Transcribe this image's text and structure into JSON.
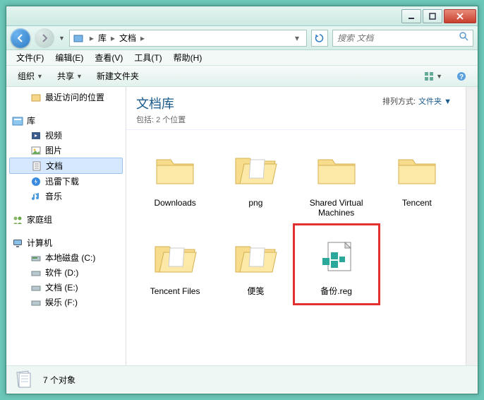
{
  "titlebar": {},
  "nav": {
    "breadcrumb": {
      "root": "库",
      "current": "文档"
    }
  },
  "search": {
    "placeholder": "搜索 文档"
  },
  "menubar": {
    "file": "文件(F)",
    "edit": "编辑(E)",
    "view": "查看(V)",
    "tools": "工具(T)",
    "help": "帮助(H)"
  },
  "toolbar": {
    "organize": "组织",
    "share": "共享",
    "newfolder": "新建文件夹"
  },
  "sidebar": {
    "recent": "最近访问的位置",
    "libraries": "库",
    "lib_items": {
      "videos": "视频",
      "pictures": "图片",
      "documents": "文档",
      "xunlei": "迅雷下载",
      "music": "音乐"
    },
    "homegroup": "家庭组",
    "computer": "计算机",
    "drives": {
      "c": "本地磁盘 (C:)",
      "d": "软件 (D:)",
      "e": "文档 (E:)",
      "f": "娱乐 (F:)"
    }
  },
  "header": {
    "title": "文档库",
    "subtitle": "包括: 2 个位置",
    "sort_label": "排列方式:",
    "sort_value": "文件夹"
  },
  "items": [
    {
      "name": "Downloads",
      "type": "folder"
    },
    {
      "name": "png",
      "type": "folder-open"
    },
    {
      "name": "Shared Virtual Machines",
      "type": "folder"
    },
    {
      "name": "Tencent",
      "type": "folder"
    },
    {
      "name": "Tencent Files",
      "type": "folder-open"
    },
    {
      "name": "便笺",
      "type": "folder-open"
    },
    {
      "name": "备份.reg",
      "type": "reg",
      "highlight": true
    }
  ],
  "statusbar": {
    "count": "7 个对象"
  }
}
